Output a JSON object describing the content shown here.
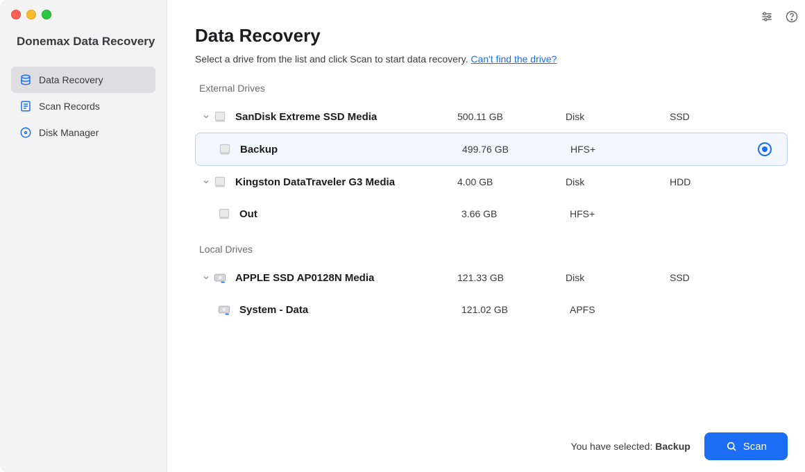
{
  "app_title": "Donemax Data Recovery",
  "nav": [
    {
      "label": "Data Recovery"
    },
    {
      "label": "Scan Records"
    },
    {
      "label": "Disk Manager"
    }
  ],
  "page": {
    "title": "Data Recovery",
    "subtitle_text": "Select a drive from the list and click Scan to start data recovery. ",
    "subtitle_link": "Can't find the drive?"
  },
  "sections": [
    {
      "heading": "External Drives",
      "drives": [
        {
          "name": "SanDisk Extreme SSD Media",
          "size": "500.11 GB",
          "type": "Disk",
          "subtype": "SSD",
          "volumes": [
            {
              "name": "Backup",
              "size": "499.76 GB",
              "type": "HFS+",
              "subtype": "",
              "selected": true
            }
          ]
        },
        {
          "name": "Kingston DataTraveler G3 Media",
          "size": "4.00 GB",
          "type": "Disk",
          "subtype": "HDD",
          "volumes": [
            {
              "name": "Out",
              "size": "3.66 GB",
              "type": "HFS+",
              "subtype": "",
              "selected": false
            }
          ]
        }
      ]
    },
    {
      "heading": "Local Drives",
      "drives": [
        {
          "name": "APPLE SSD AP0128N Media",
          "size": "121.33 GB",
          "type": "Disk",
          "subtype": "SSD",
          "volumes": [
            {
              "name": "System - Data",
              "size": "121.02 GB",
              "type": "APFS",
              "subtype": "",
              "selected": false
            }
          ]
        }
      ]
    }
  ],
  "footer": {
    "selected_prefix": "You have selected: ",
    "selected_name": "Backup",
    "scan_label": "Scan"
  }
}
